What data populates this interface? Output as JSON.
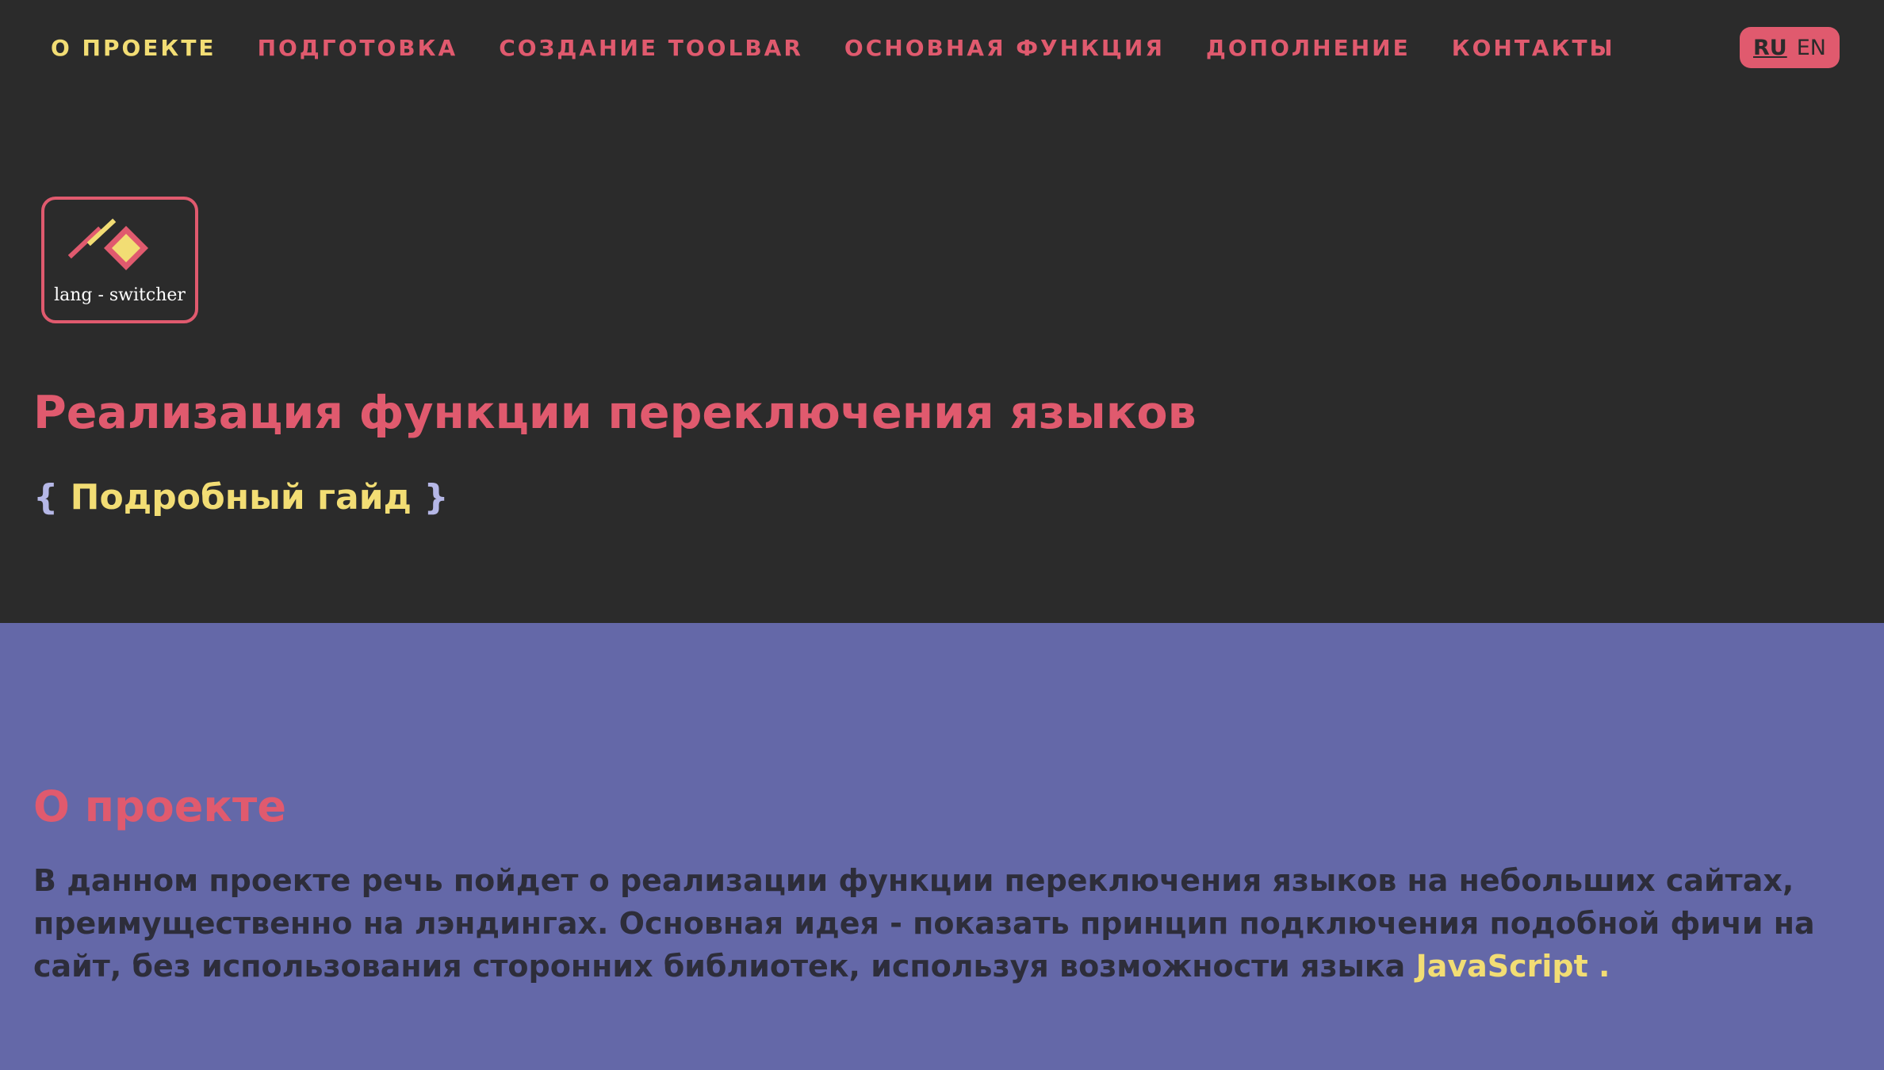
{
  "nav": {
    "items": [
      {
        "label": "О ПРОЕКТЕ",
        "active": true
      },
      {
        "label": "ПОДГОТОВКА",
        "active": false
      },
      {
        "label": "СОЗДАНИЕ TOOLBAR",
        "active": false
      },
      {
        "label": "ОСНОВНАЯ ФУНКЦИЯ",
        "active": false
      },
      {
        "label": "ДОПОЛНЕНИЕ",
        "active": false
      },
      {
        "label": "КОНТАКТЫ",
        "active": false
      }
    ],
    "lang": {
      "current": "RU",
      "other": "EN"
    }
  },
  "hero": {
    "logo_text": "lang - switcher",
    "title": "Реализация функции переключения языков",
    "subtitle_open": "{",
    "subtitle": "Подробный гайд",
    "subtitle_close": "}"
  },
  "about": {
    "title": "О проекте",
    "line1": "В данном проекте речь пойдет о реализации функции переключения языков на небольших сайтах,",
    "line2": "преимущественно на лэндингах. Основная идея - показать принцип подключения подобной фичи на",
    "line3": "сайт, без использования сторонних библиотек, используя возможности языка",
    "highlight": "JavaScript ."
  },
  "colors": {
    "background_dark": "#2b2b2b",
    "accent_pink": "#e05a6e",
    "accent_yellow": "#f2dd74",
    "section_purple": "#6468a8",
    "text_dark": "#2d2d3a",
    "brace_lavender": "#b5b7e6"
  }
}
